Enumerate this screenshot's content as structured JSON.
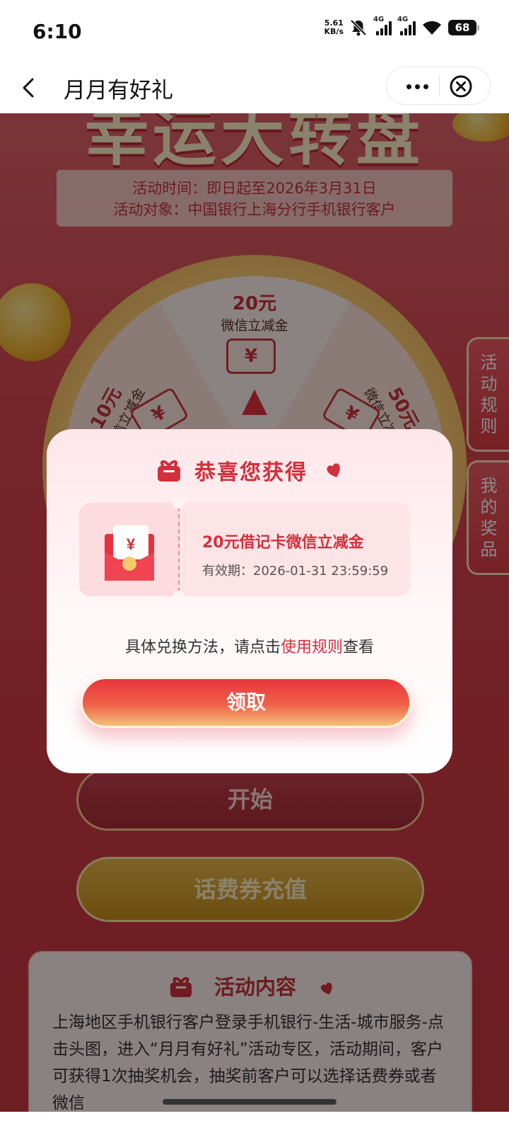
{
  "status_bar": {
    "time": "6:10",
    "speed": "5.61\nKB/s",
    "network_1": "4G",
    "network_2": "4G",
    "battery": "68"
  },
  "nav": {
    "title": "月月有好礼"
  },
  "hero": {
    "title": "幸运大转盘",
    "activity_time": "活动时间：即日起至2026年3月31日",
    "activity_target": "活动对象：中国银行上海分行手机银行客户"
  },
  "wheel": {
    "prizes": [
      {
        "amount": "20元",
        "desc": "微信立减金",
        "ticket": "¥"
      },
      {
        "amount": "10元",
        "desc": "微信立减金",
        "ticket": "¥"
      },
      {
        "amount": "50元",
        "desc": "微信立减金",
        "ticket": "¥"
      }
    ]
  },
  "side_tabs": {
    "rules": "活动规则",
    "my_prizes": "我的奖品"
  },
  "buttons": {
    "start": "开始",
    "recharge": "话费券充值"
  },
  "content": {
    "heading": "活动内容",
    "body": "上海地区手机银行客户登录手机银行-生活-城市服务-点击头图，进入“月月有好礼”活动专区，活动期间，客户可获得1次抽奖机会，抽奖前客户可以选择话费券或者微信"
  },
  "modal": {
    "title": "恭喜您获得",
    "coupon_name": "20元借记卡微信立减金",
    "coupon_validity": "有效期：2026-01-31 23:59:59",
    "envelope_symbol": "¥",
    "hint_prefix": "具体兑换方法，请点击",
    "hint_link": "使用规则",
    "hint_suffix": "查看",
    "claim_button": "领取"
  },
  "colors": {
    "accent": "#d2303c",
    "page_red": "#d9464f",
    "gold": "#e7b64b"
  }
}
